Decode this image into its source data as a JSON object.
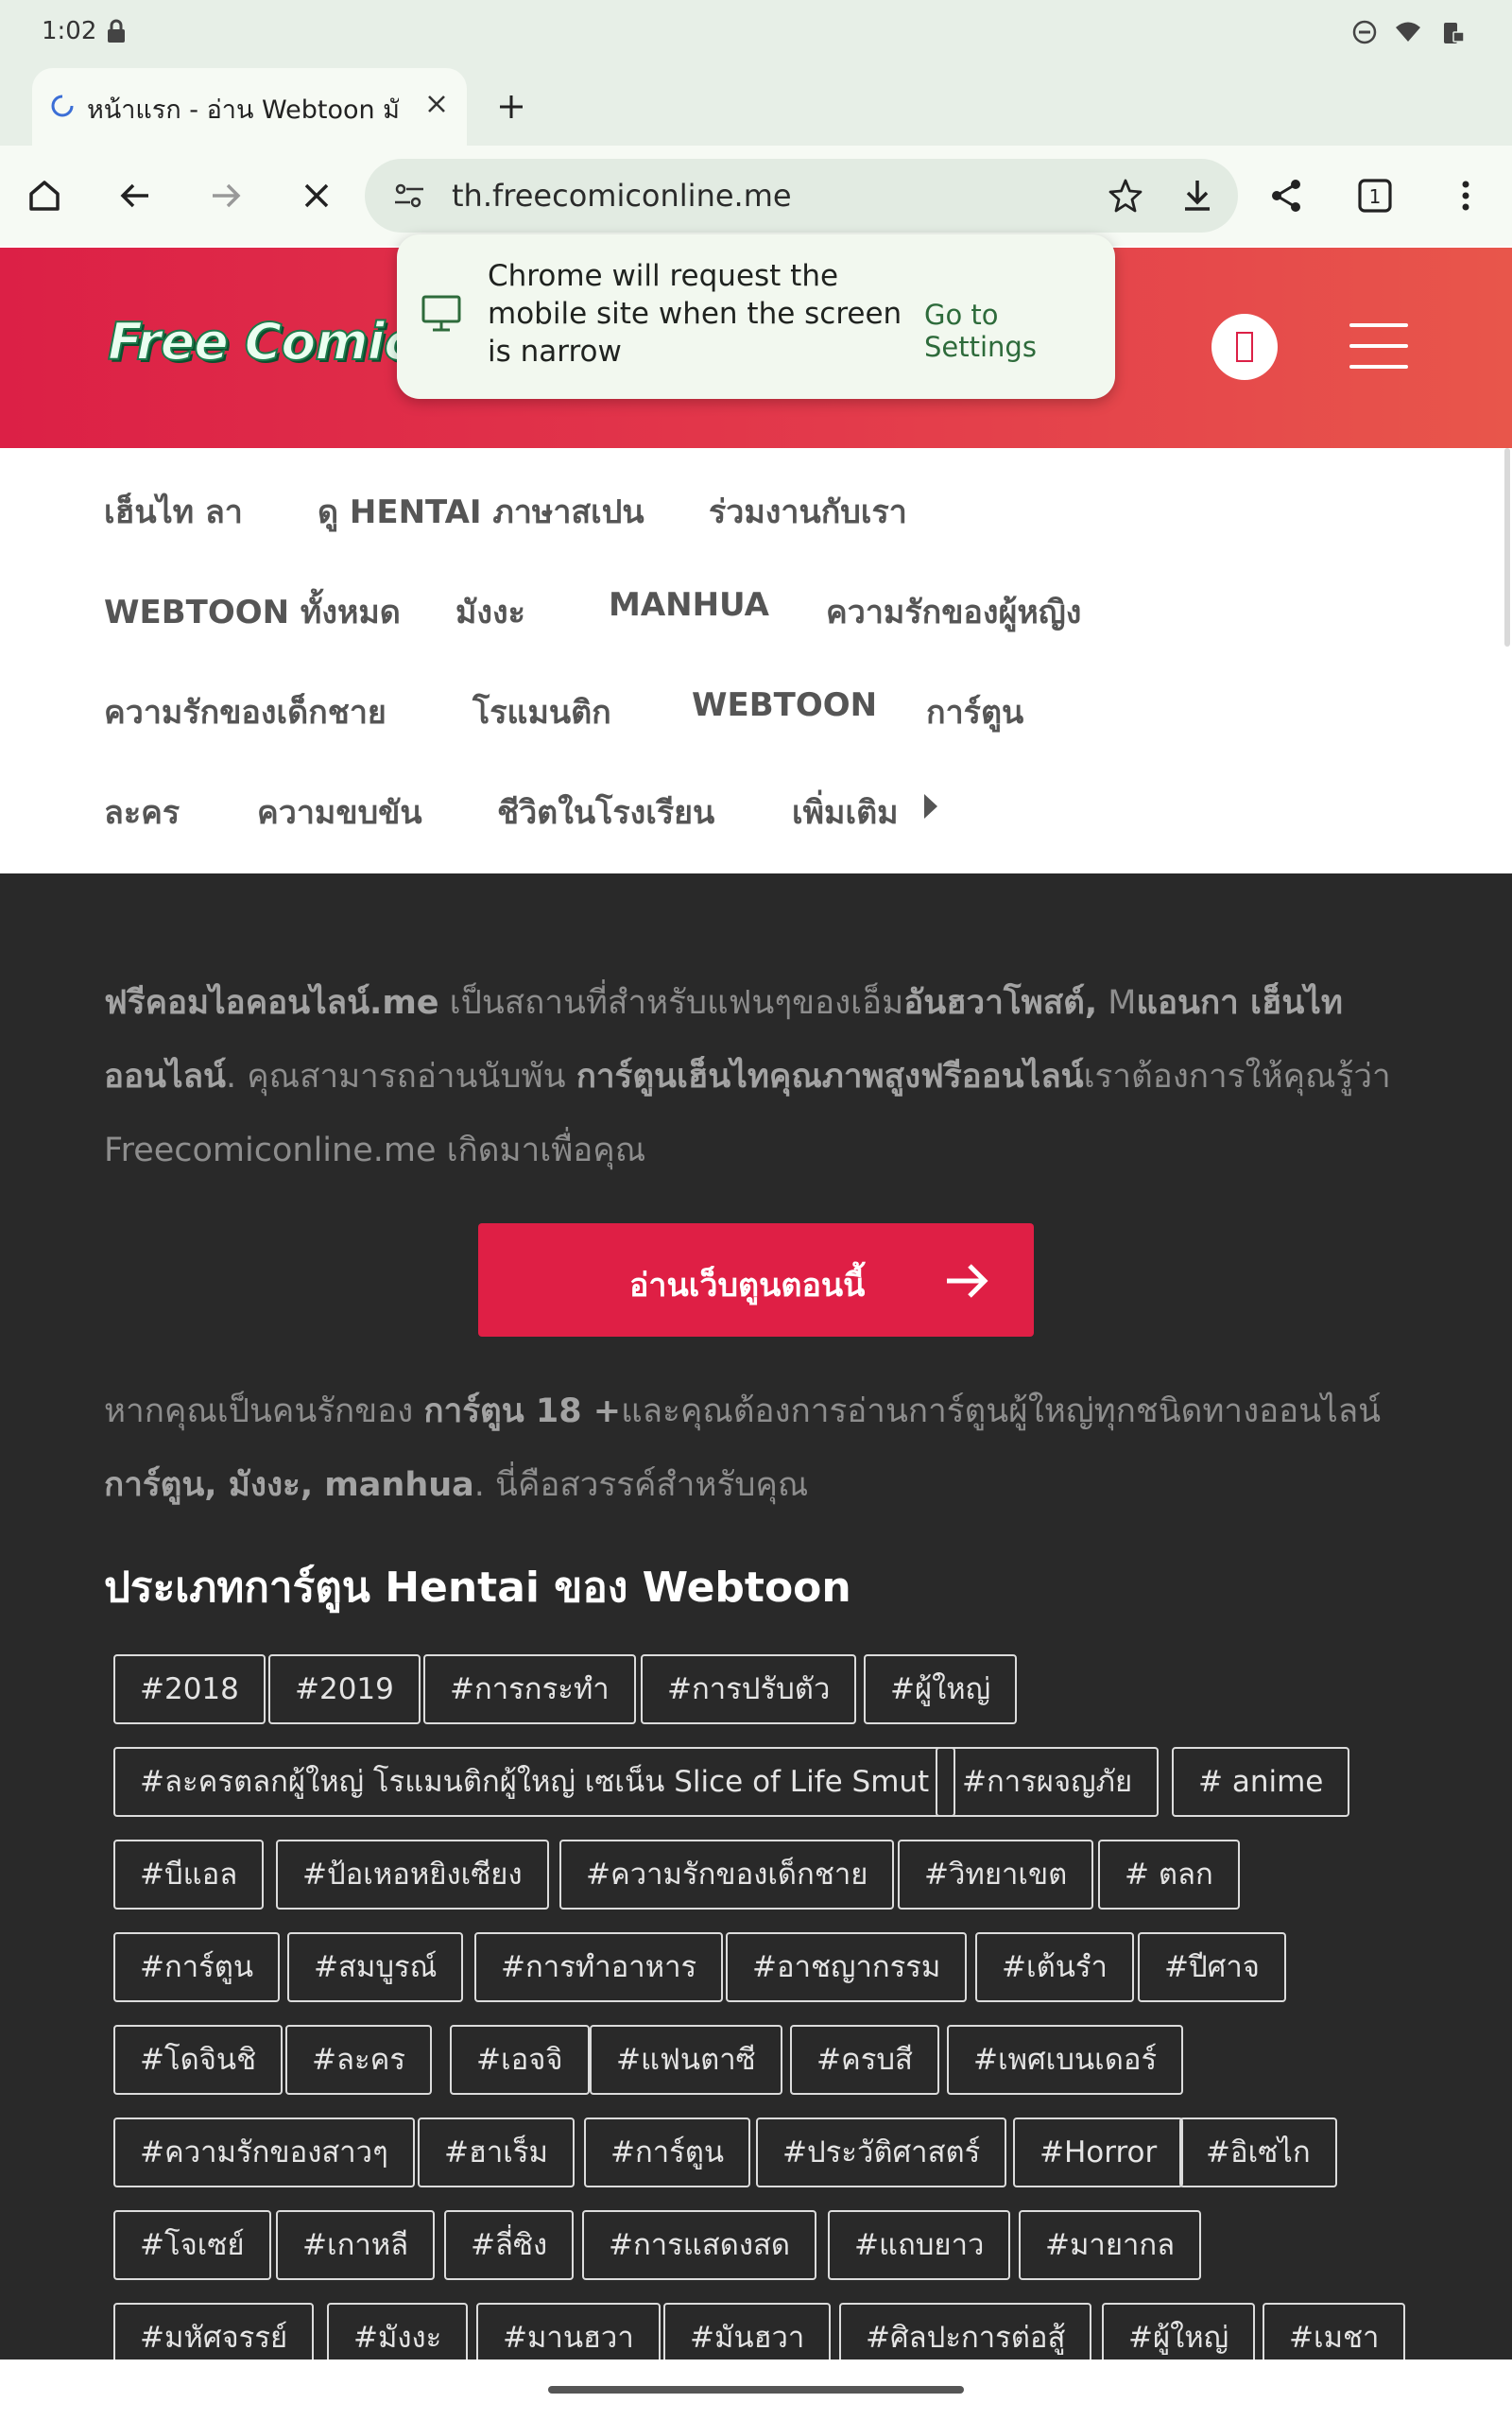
{
  "status": {
    "time": "1:02"
  },
  "tab": {
    "title": "หน้าแรก - อ่าน Webtoon มังงะ"
  },
  "toolbar": {
    "url": "th.freecomiconline.me",
    "tab_count": "1"
  },
  "popup": {
    "message": "Chrome will request the mobile site when the screen is narrow",
    "action": "Go to Settings"
  },
  "site": {
    "logo_text": "Free Comic",
    "logo_partial": "O"
  },
  "nav": {
    "items": [
      "เฮ็นไท ลา",
      "ดู HENTAI ภาษาสเปน",
      "ร่วมงานกับเรา",
      "WEBTOON ทั้งหมด",
      "มังงะ",
      "MANHUA",
      "ความรักของผู้หญิง",
      "ความรักของเด็กชาย",
      "โรแมนติก",
      "WEBTOON",
      "การ์ตูน",
      "ละคร",
      "ความขบขัน",
      "ชีวิตในโรงเรียน",
      "เพิ่มเติม"
    ]
  },
  "intro": {
    "p1_b1": "ฟรีคอมไอคอนไลน์.me",
    "p1_t1": " เป็นสถานที่สำหรับแฟนๆของเอ็ม",
    "p1_b2": "อันฮวาโพสต์,",
    "p1_t2": " M",
    "p1_b3": "แอนกา เฮ็นไท ออนไลน์",
    "p1_t3": ". คุณสามารถอ่านนับพัน ",
    "p1_b4": "การ์ตูนเฮ็นไทคุณภาพสูงฟรีออนไลน์",
    "p1_t4": "เราต้องการให้คุณรู้ว่า Freecomiconline.me เกิดมาเพื่อคุณ",
    "cta": "อ่านเว็บตูนตอนนี้",
    "p2_t1": "หากคุณเป็นคนรักของ ",
    "p2_b1": "การ์ตูน 18 +",
    "p2_t2": "และคุณต้องการอ่านการ์ตูนผู้ใหญ่ทุกชนิดทางออนไลน์ ",
    "p2_b2": "การ์ตูน, มังงะ, manhua",
    "p2_t3": ". นี่คือสวรรค์สำหรับคุณ",
    "section_title": "ประเภทการ์ตูน Hentai ของ Webtoon"
  },
  "tags": [
    "#2018",
    "#2019",
    "#การกระทำ",
    "#การปรับตัว",
    "#ผู้ใหญ่",
    "#ละครตลกผู้ใหญ่ โรแมนติกผู้ใหญ่ เซเน็น Slice of Life Smut",
    "#การผจญภัย",
    "# anime",
    "#บีแอล",
    "#ป้อเหอหยิงเซียง",
    "#ความรักของเด็กชาย",
    "#วิทยาเขต",
    "# ตลก",
    "#การ์ตูน",
    "#สมบูรณ์",
    "#การทำอาหาร",
    "#อาชญากรรม",
    "#เต้นรำ",
    "#ปีศาจ",
    "#โดจินชิ",
    "#ละคร",
    "#เอจจิ",
    "#แฟนตาซี",
    "#ครบสี",
    "#เพศเบนเดอร์",
    "#ความรักของสาวๆ",
    "#ฮาเร็ม",
    "#การ์ตูน",
    "#ประวัติศาสตร์",
    "#Horror",
    "#อิเซไก",
    "#โจเซย์",
    "#เกาหลี",
    "#ลี่ซิง",
    "#การแสดงสด",
    "#แถบยาว",
    "#มายากล",
    "#มหัศจรรย์",
    "#มังงะ",
    "#มานฮวา",
    "#มันฮวา",
    "#ศิลปะการต่อสู้",
    "#ผู้ใหญ่",
    "#เมชา"
  ]
}
